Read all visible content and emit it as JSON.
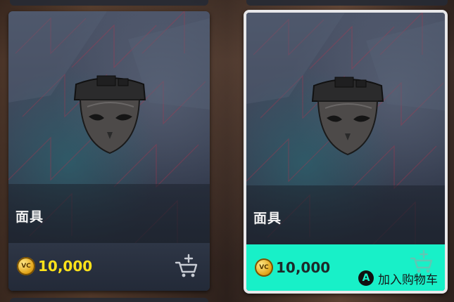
{
  "items": [
    {
      "name": "面具",
      "currency_label": "VC",
      "price": "10,000",
      "selected": false
    },
    {
      "name": "面具",
      "currency_label": "VC",
      "price": "10,000",
      "selected": true,
      "action_button": "A",
      "action_label": "加入购物车"
    }
  ],
  "colors": {
    "price_yellow": "#ffe21a",
    "selected_accent": "#18f0c8",
    "selected_border": "#e8e8ea",
    "card_bg": "#2a3140"
  },
  "icons": {
    "currency": "vc-coin-icon",
    "cart": "add-to-cart-icon",
    "item": "mask-icon",
    "button": "a-button-icon"
  }
}
